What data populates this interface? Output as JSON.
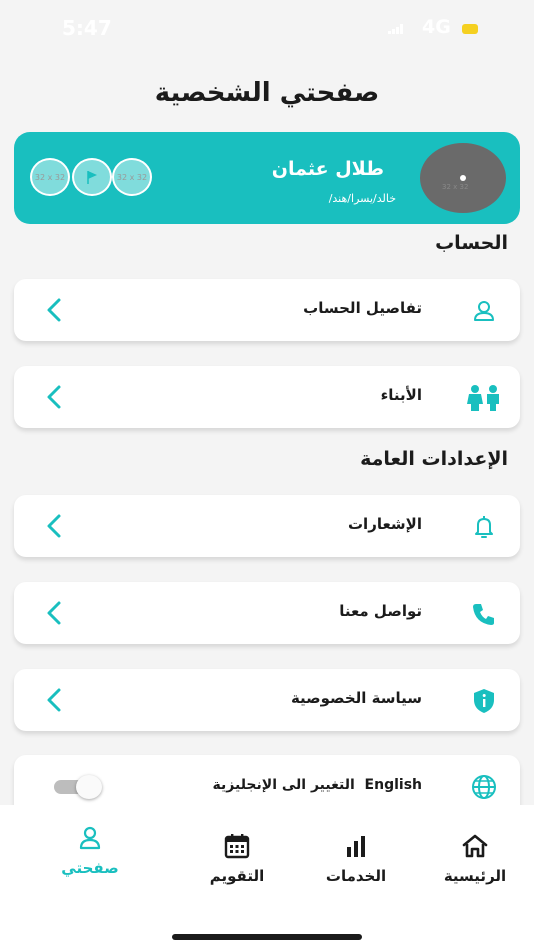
{
  "status_bar": {
    "time": "5:47",
    "network": "4G"
  },
  "page_title": "صفحتي الشخصية",
  "profile": {
    "name": "طلال عثمان",
    "children": "خالد/يسرا/هند/",
    "avatar_placeholder": "32 x 32",
    "kids_placeholders": [
      "32 x 32",
      "",
      "32 x 32"
    ]
  },
  "sections": {
    "account": "الحساب",
    "general_settings": "الإعدادات العامة"
  },
  "menu": {
    "account_details": "تفاصيل الحساب",
    "children": "الأبناء",
    "notifications": "الإشعارات",
    "contact_us": "تواصل معنا",
    "privacy_policy": "سياسة الخصوصية",
    "language_english": "English",
    "language_change": "التغيير الى الإنجليزية"
  },
  "language_toggle_on": false,
  "nav": {
    "home": "الرئيسية",
    "services": "الخدمات",
    "calendar": "التقويم",
    "my_page": "صفحتي"
  },
  "colors": {
    "accent": "#19bfbf",
    "text": "#1b1b1b",
    "background": "#f4f4f4"
  },
  "icons": [
    "user-icon",
    "children-icon",
    "bell-icon",
    "phone-icon",
    "shield-icon",
    "globe-icon",
    "home-icon",
    "chart-icon",
    "calendar-icon",
    "chevron-left-icon"
  ]
}
